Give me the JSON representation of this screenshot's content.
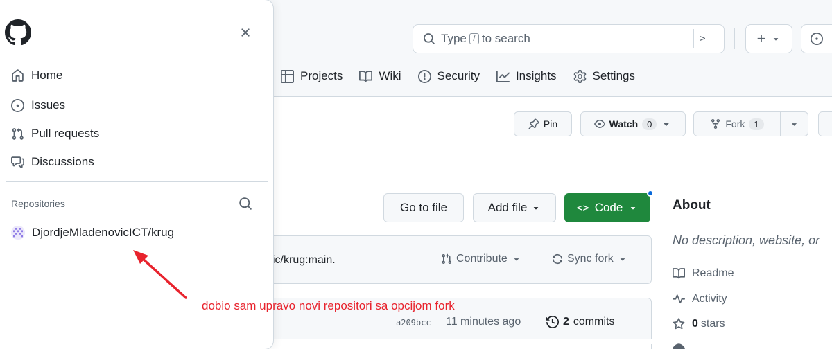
{
  "header": {
    "search_placeholder_pre": "Type",
    "search_key": "/",
    "search_placeholder_post": "to search",
    "cmd_glyph": ">_",
    "new_glyph": "+"
  },
  "repo_nav": [
    {
      "label": "Projects",
      "icon": "table-icon"
    },
    {
      "label": "Wiki",
      "icon": "book-icon"
    },
    {
      "label": "Security",
      "icon": "shield-icon"
    },
    {
      "label": "Insights",
      "icon": "graph-icon"
    },
    {
      "label": "Settings",
      "icon": "gear-icon"
    }
  ],
  "repo_actions": {
    "pin_label": "Pin",
    "watch_label": "Watch",
    "watch_count": "0",
    "fork_label": "Fork",
    "fork_count": "1"
  },
  "file_actions": {
    "go_to_file": "Go to file",
    "add_file": "Add file",
    "code": "Code",
    "code_glyph": "<>"
  },
  "fork_bar": {
    "text": "vic/krug:main.",
    "contribute": "Contribute",
    "sync_fork": "Sync fork"
  },
  "commit": {
    "hash": "a209bcc",
    "time": "11 minutes ago",
    "count": "2",
    "count_label": "commits"
  },
  "about": {
    "title": "About",
    "description": "No description, website, or",
    "readme": "Readme",
    "activity": "Activity",
    "stars_count": "0",
    "stars_label": "stars"
  },
  "drawer": {
    "nav": [
      {
        "label": "Home",
        "icon": "home-icon"
      },
      {
        "label": "Issues",
        "icon": "issue-opened-icon"
      },
      {
        "label": "Pull requests",
        "icon": "git-pull-request-icon"
      },
      {
        "label": "Discussions",
        "icon": "comment-discussion-icon"
      }
    ],
    "repositories_heading": "Repositories",
    "repositories": [
      {
        "name": "DjordjeMladenovicICT/krug"
      }
    ]
  },
  "annotation": {
    "text": "dobio sam upravo novi repositori sa opcijom fork",
    "color": "#e8232d"
  },
  "colors": {
    "accent_green": "#1f883d",
    "accent_blue": "#0969da",
    "muted_text": "#59636e",
    "border": "#d1d9e0"
  }
}
